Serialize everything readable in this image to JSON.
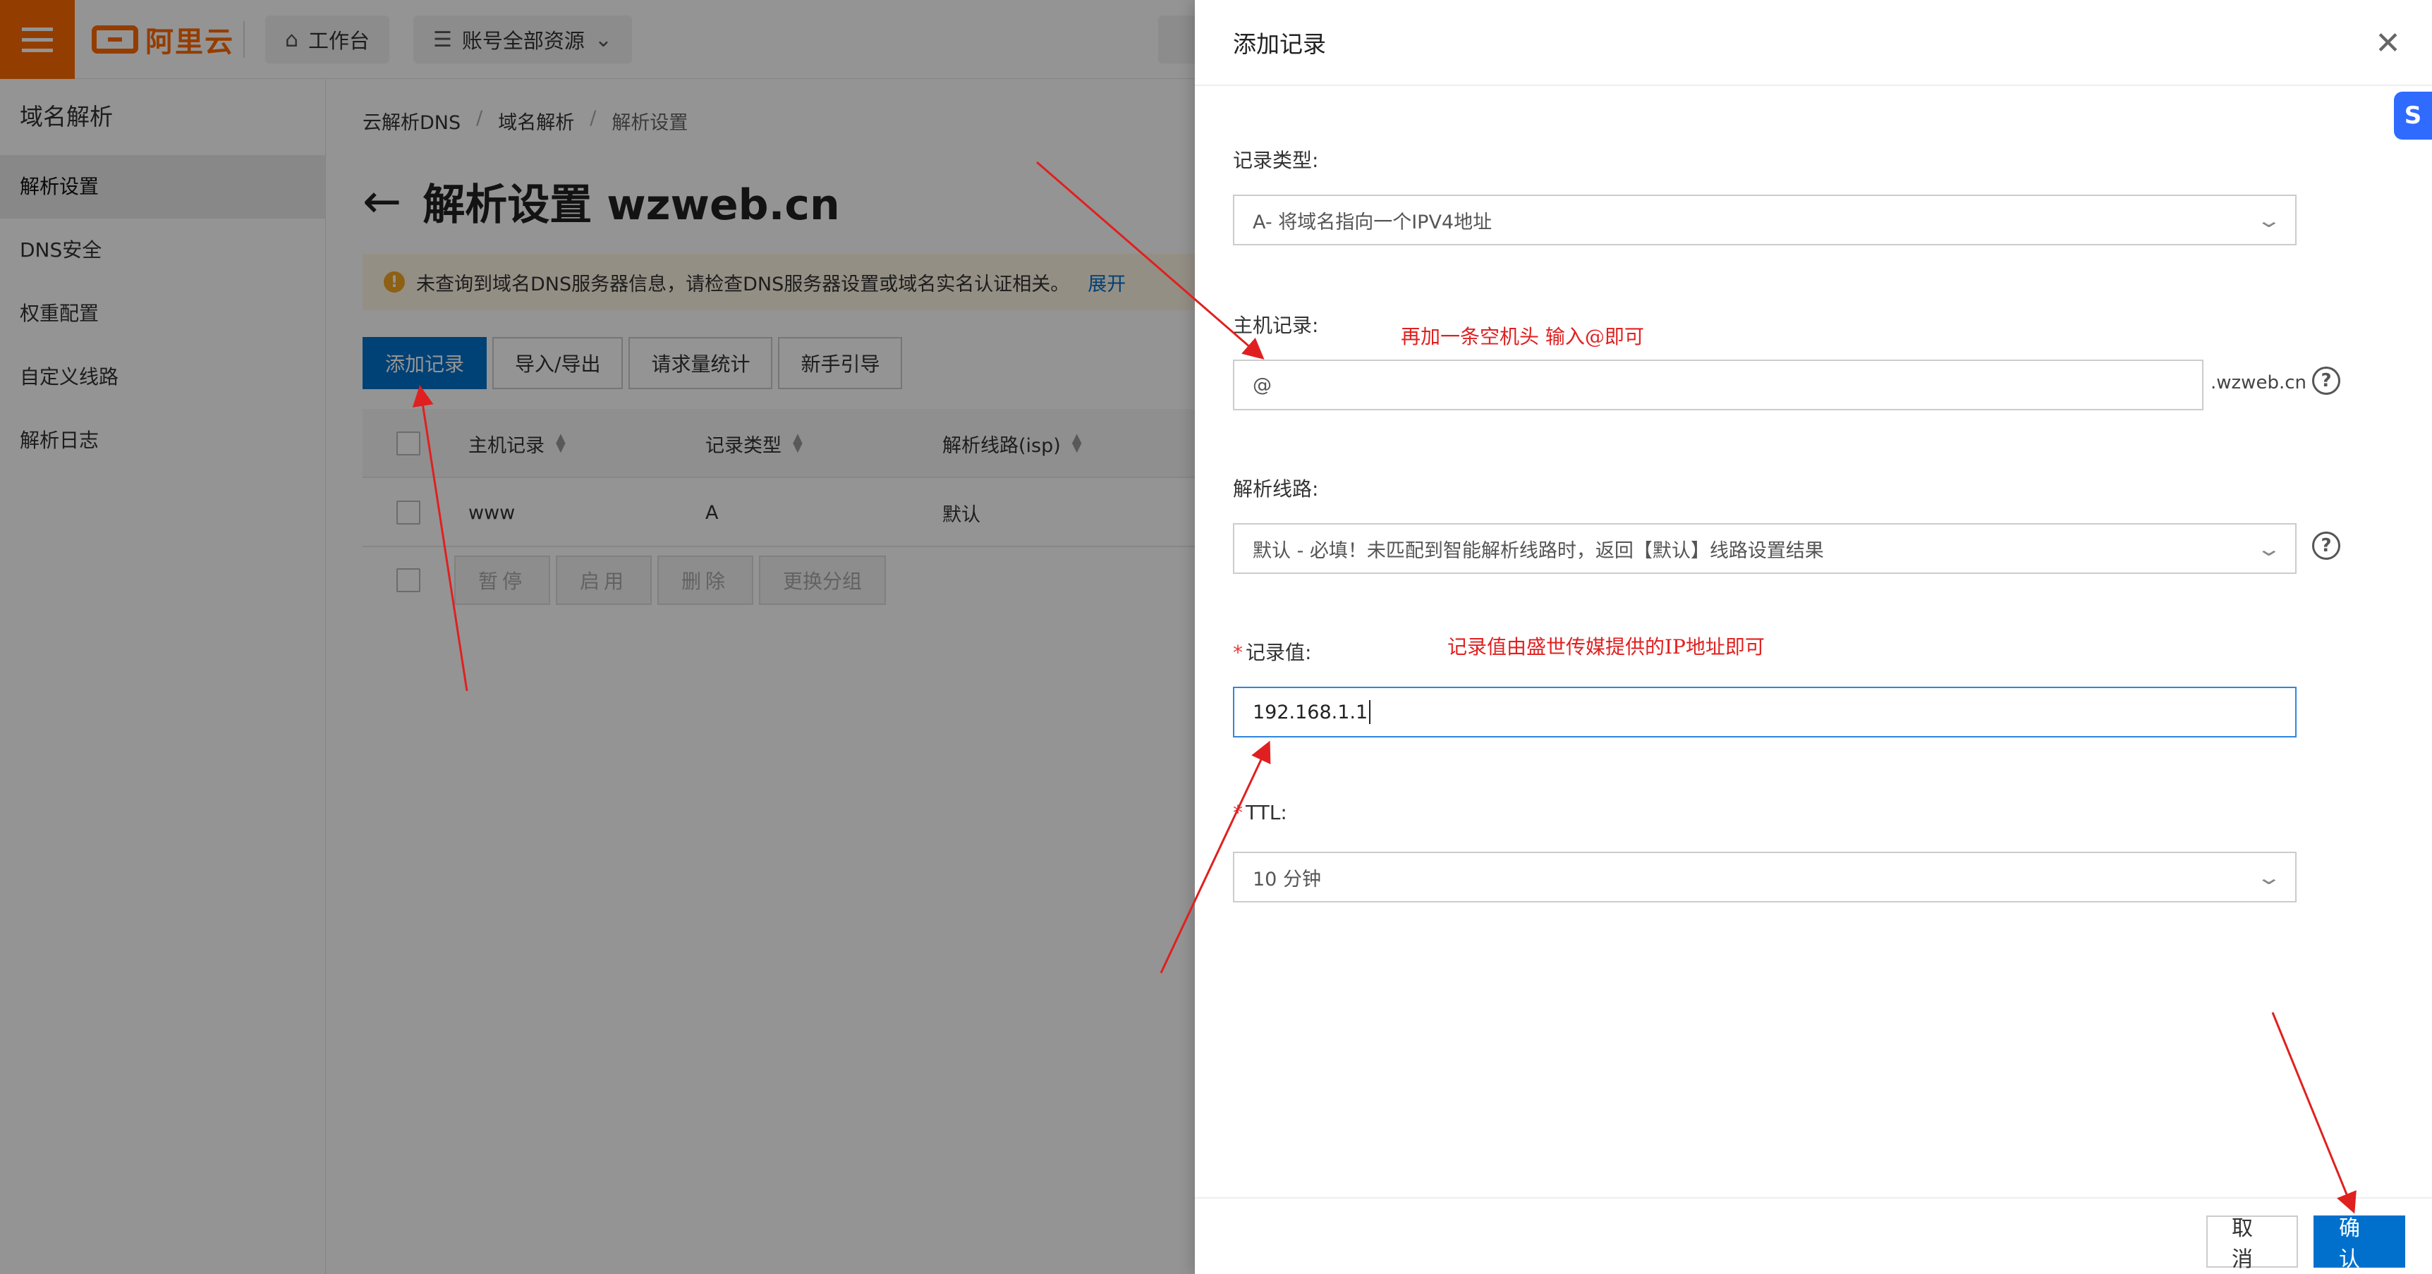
{
  "topbar": {
    "logo_text": "阿里云",
    "workbench_label": "工作台",
    "resources_label": "账号全部资源"
  },
  "sidebar": {
    "title": "域名解析",
    "items": [
      {
        "label": "解析设置",
        "active": true
      },
      {
        "label": "DNS安全"
      },
      {
        "label": "权重配置"
      },
      {
        "label": "自定义线路"
      },
      {
        "label": "解析日志"
      }
    ]
  },
  "breadcrumb": [
    "云解析DNS",
    "域名解析",
    "解析设置"
  ],
  "page_title": "解析设置 wzweb.cn",
  "notice": {
    "text": "未查询到域名DNS服务器信息，请检查DNS服务器设置或域名实名认证相关。",
    "expand_label": "展开"
  },
  "toolbar": {
    "add_record": "添加记录",
    "import_export": "导入/导出",
    "request_stats": "请求量统计",
    "guide": "新手引导"
  },
  "table": {
    "columns": [
      "主机记录",
      "记录类型",
      "解析线路(isp)"
    ],
    "rows": [
      {
        "host": "www",
        "type": "A",
        "line": "默认"
      }
    ],
    "bulk_actions": [
      "暂停",
      "启用",
      "删除",
      "更换分组"
    ]
  },
  "drawer": {
    "title": "添加记录",
    "record_type": {
      "label": "记录类型:",
      "value": "A- 将域名指向一个IPV4地址"
    },
    "host_record": {
      "label": "主机记录:",
      "value": "@",
      "suffix": ".wzweb.cn"
    },
    "line": {
      "label": "解析线路:",
      "value": "默认 - 必填！未匹配到智能解析线路时，返回【默认】线路设置结果"
    },
    "record_value": {
      "label": "记录值:",
      "value": "192.168.1.1"
    },
    "ttl": {
      "label": "TTL:",
      "value": "10 分钟"
    },
    "cancel_label": "取 消",
    "confirm_label": "确 认"
  },
  "annotations": {
    "host_hint": "再加一条空机头  输入@即可",
    "value_hint": "记录值由盛世传媒提供的IP地址即可"
  },
  "colors": {
    "brand_orange": "#ff6a00",
    "primary_blue": "#0070cc",
    "annotation_red": "#e02020"
  }
}
